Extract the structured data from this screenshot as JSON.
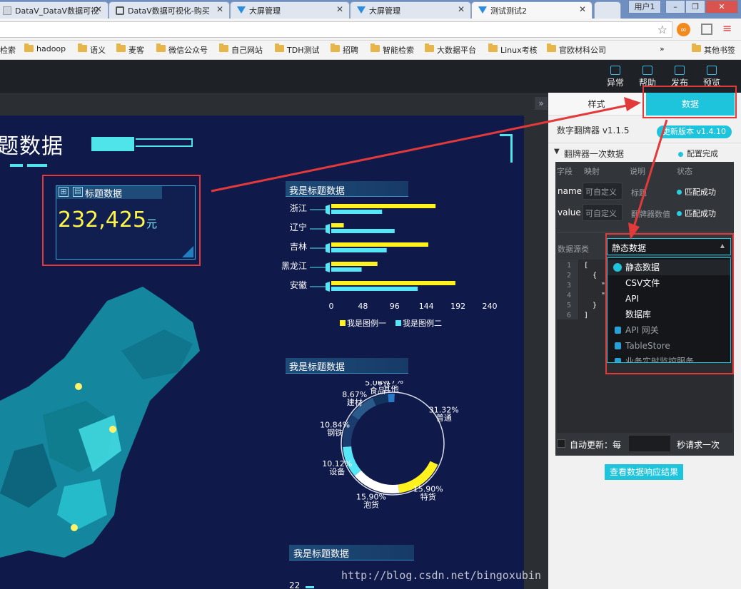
{
  "browser": {
    "tabs": [
      {
        "label": "DataV_DataV数据可视"
      },
      {
        "label": "DataV数据可视化-购买"
      },
      {
        "label": "大屏管理"
      },
      {
        "label": "大屏管理"
      },
      {
        "label": "测试测试2"
      }
    ],
    "user_label": "用户1",
    "bookmarks": [
      "检索",
      "hadoop",
      "语义",
      "麦客",
      "微信公众号",
      "自己网站",
      "TDH测试",
      "招聘",
      "智能检索",
      "大数据平台",
      "Linux考核",
      "官欧材科公司"
    ],
    "bookmarks_more": "»",
    "other_bookmarks": "其他书签"
  },
  "header": {
    "actions": [
      {
        "label": "异常",
        "icon": "alert-icon"
      },
      {
        "label": "帮助",
        "icon": "help-icon"
      },
      {
        "label": "发布",
        "icon": "send-icon"
      },
      {
        "label": "预览",
        "icon": "preview-icon"
      }
    ]
  },
  "canvas": {
    "title_fragment": "题数据",
    "card": {
      "title": "标题数据",
      "number": "232,425",
      "unit": "元"
    },
    "bar_title": "我是标题数据",
    "donut_title": "我是标题数据",
    "bottom_title": "我是标题数据",
    "bottom_value": "22",
    "watermark": "http://blog.csdn.net/bingoxubin"
  },
  "chart_data": [
    {
      "type": "bar",
      "title": "我是标题数据",
      "categories": [
        "浙江",
        "辽宁",
        "吉林",
        "黑龙江",
        "安徽"
      ],
      "series": [
        {
          "name": "我是图例一",
          "values": [
            158,
            19,
            147,
            70,
            188
          ]
        },
        {
          "name": "我是图例二",
          "values": [
            77,
            96,
            84,
            46,
            131
          ]
        }
      ],
      "xlim": [
        0,
        240
      ],
      "xticks": [
        "0",
        "48",
        "96",
        "144",
        "192",
        "240"
      ],
      "colors": [
        "#fff21f",
        "#56e6f5"
      ],
      "legend": "bottom"
    },
    {
      "type": "pie",
      "title": "我是标题数据",
      "slices": [
        {
          "label": "普通",
          "value": 31.32,
          "pct": "31.32%"
        },
        {
          "label": "特货",
          "value": 15.9,
          "pct": "15.90%"
        },
        {
          "label": "泡货",
          "value": 15.9,
          "pct": "15.90%"
        },
        {
          "label": "设备",
          "value": 10.12,
          "pct": "10.12%"
        },
        {
          "label": "钢铁",
          "value": 10.84,
          "pct": "10.84%"
        },
        {
          "label": "建材",
          "value": 8.67,
          "pct": "8.67%"
        },
        {
          "label": "食品",
          "value": 5.06,
          "pct": "5.06%"
        },
        {
          "label": "其他",
          "value": 2.17,
          "pct": "2.17%"
        }
      ]
    }
  ],
  "panel": {
    "tabs": [
      {
        "label": "样式"
      },
      {
        "label": "数据"
      }
    ],
    "component": "数字翻牌器 v1.1.5",
    "update_badge": "更新版本 v1.4.10",
    "section": "翻牌器一次数据",
    "config_status": "配置完成",
    "table_headers": {
      "field": "字段",
      "mapping": "映射",
      "desc": "说明",
      "state": "状态"
    },
    "rows": [
      {
        "field": "name",
        "placeholder": "可自定义",
        "desc": "标题",
        "status": "匹配成功"
      },
      {
        "field": "value",
        "placeholder": "可自定义",
        "desc": "翻牌器数值",
        "status": "匹配成功"
      }
    ],
    "source_label": "数据源类",
    "source_selected": "静态数据",
    "source_options": [
      {
        "label": "静态数据",
        "locked": false
      },
      {
        "label": "CSV文件",
        "locked": false
      },
      {
        "label": "API",
        "locked": false
      },
      {
        "label": "数据库",
        "locked": false
      },
      {
        "label": "API 网关",
        "locked": true
      },
      {
        "label": "TableStore",
        "locked": true
      },
      {
        "label": "业务实时监控服务",
        "locked": true
      }
    ],
    "code_lines": [
      "[",
      "{",
      "\"",
      "\"",
      "}",
      "]"
    ],
    "line_numbers": [
      "1",
      "2",
      "3",
      "4",
      "5",
      "6"
    ],
    "auto_update": "自动更新：每",
    "auto_suffix": "秒请求一次",
    "view_button": "查看数据响应结果"
  },
  "colors": {
    "accent": "#1ec3dc",
    "canvas_bg": "#0f1a4a",
    "annotation": "#e23a3a"
  }
}
